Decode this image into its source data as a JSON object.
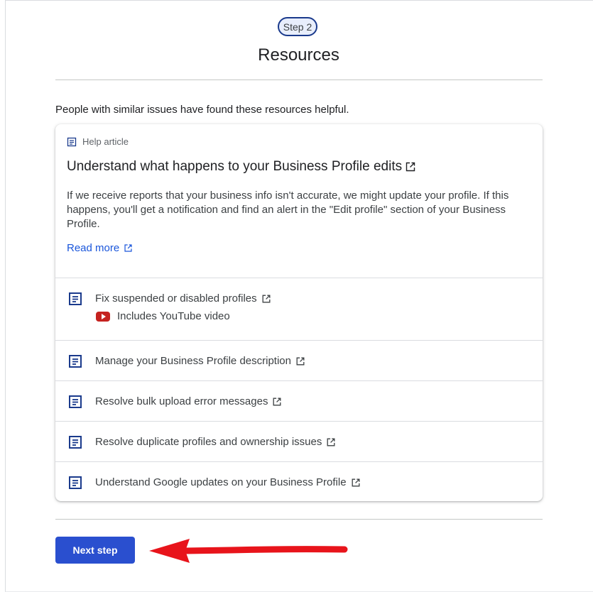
{
  "header": {
    "step_label": "Step 2",
    "title": "Resources"
  },
  "intro_text": "People with similar issues have found these resources helpful.",
  "featured_article": {
    "type_label": "Help article",
    "title": "Understand what happens to your Business Profile edits",
    "body": "If we receive reports that your business info isn't accurate, we might update your profile. If this happens, you'll get a notification and find an alert in the \"Edit profile\" section of your Business Profile.",
    "read_more_label": "Read more"
  },
  "resources": [
    {
      "label": "Fix suspended or disabled profiles",
      "badge": "Includes YouTube video"
    },
    {
      "label": "Manage your Business Profile description"
    },
    {
      "label": "Resolve bulk upload error messages"
    },
    {
      "label": "Resolve duplicate profiles and ownership issues"
    },
    {
      "label": "Understand Google updates on your Business Profile"
    }
  ],
  "next_button_label": "Next step",
  "colors": {
    "primary_button": "#2a4fcf",
    "link": "#1a56db",
    "icon_blue": "#1a3a8c",
    "annotation_arrow": "#e8141b",
    "youtube_red": "#c5221f"
  },
  "icons": {
    "document": "document-icon",
    "external_link": "external-link-icon",
    "youtube": "youtube-icon",
    "arrow": "red-arrow-annotation"
  }
}
